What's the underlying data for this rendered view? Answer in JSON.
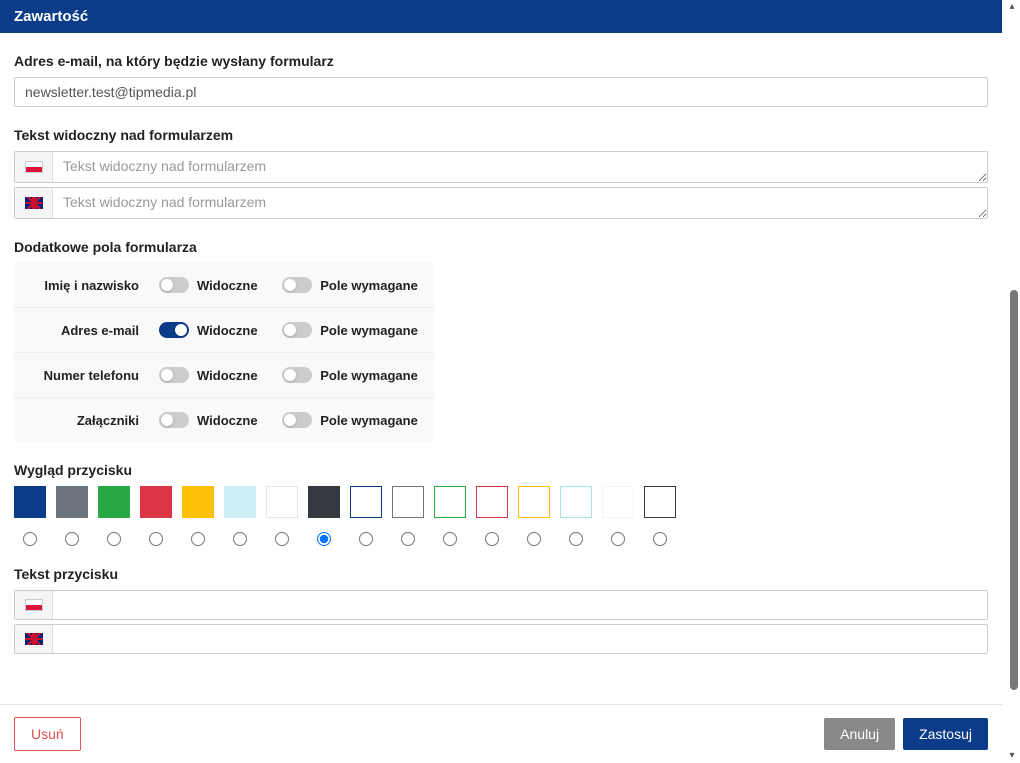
{
  "header": {
    "title": "Zawartość"
  },
  "email": {
    "label": "Adres e-mail, na który będzie wysłany formularz",
    "value": "newsletter.test@tipmedia.pl"
  },
  "above_text": {
    "label": "Tekst widoczny nad formularzem",
    "placeholder_pl": "Tekst widoczny nad formularzem",
    "placeholder_en": "Tekst widoczny nad formularzem"
  },
  "extra_fields": {
    "label": "Dodatkowe pola formularza",
    "visible_label": "Widoczne",
    "required_label": "Pole wymagane",
    "rows": [
      {
        "name": "Imię i nazwisko",
        "visible": false,
        "required": false
      },
      {
        "name": "Adres e-mail",
        "visible": true,
        "required": false
      },
      {
        "name": "Numer telefonu",
        "visible": false,
        "required": false
      },
      {
        "name": "Załączniki",
        "visible": false,
        "required": false
      }
    ]
  },
  "button_style": {
    "label": "Wygląd przycisku",
    "selected_index": 7,
    "swatches": [
      {
        "fill": "#0b3c8a",
        "border": "#0b3c8a"
      },
      {
        "fill": "#6c757d",
        "border": "#6c757d"
      },
      {
        "fill": "#28a745",
        "border": "#28a745"
      },
      {
        "fill": "#dc3545",
        "border": "#dc3545"
      },
      {
        "fill": "#ffc107",
        "border": "#ffc107"
      },
      {
        "fill": "#cdeef5",
        "border": "#cdeef5"
      },
      {
        "fill": "#ffffff",
        "border": "#e6e6e6"
      },
      {
        "fill": "#343a40",
        "border": "#343a40"
      },
      {
        "fill": "#ffffff",
        "border": "#0b3c8a"
      },
      {
        "fill": "#ffffff",
        "border": "#6c757d"
      },
      {
        "fill": "#ffffff",
        "border": "#28a745"
      },
      {
        "fill": "#ffffff",
        "border": "#dc3545"
      },
      {
        "fill": "#ffffff",
        "border": "#ffc107"
      },
      {
        "fill": "#ffffff",
        "border": "#a9e2ef"
      },
      {
        "fill": "#ffffff",
        "border": "#f4f4f4"
      },
      {
        "fill": "#ffffff",
        "border": "#343a40"
      }
    ]
  },
  "button_text": {
    "label": "Tekst przycisku",
    "value_pl": "",
    "value_en": ""
  },
  "footer": {
    "delete": "Usuń",
    "cancel": "Anuluj",
    "apply": "Zastosuj"
  }
}
